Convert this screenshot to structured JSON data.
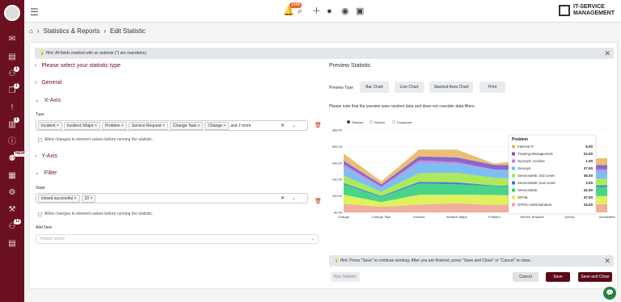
{
  "top": {
    "bell_badge": "1948",
    "logo_line1": "IT-SERVICE",
    "logo_line2": "MANAGEMENT"
  },
  "sidebar": {
    "badges": [
      "1",
      "1",
      "1",
      "1",
      "NEW",
      "11"
    ]
  },
  "breadcrumb": {
    "items": [
      "Statistics & Reports",
      "Edit Statistic"
    ]
  },
  "hint_top": "Hint: All fields marked with an asterisk (*) are mandatory.",
  "sections": {
    "s1": "Please select your statistic type",
    "s2": "General",
    "s3": "X-Axis",
    "s4": "Y-Axis",
    "s5": "Filter"
  },
  "xaxis": {
    "label": "Type",
    "tags": [
      "Incident",
      "Incident::Major",
      "Problem",
      "Service Request",
      "Change Task",
      "Change"
    ],
    "more": "and 2 more",
    "checkbox": "Allow changes to element values before running the statistic."
  },
  "filter": {
    "label": "State",
    "tags": [
      "closed successful",
      "23"
    ],
    "checkbox": "Allow changes to element values before running the statistic.",
    "add_new_label": "Add New",
    "add_new_placeholder": "Please select"
  },
  "preview": {
    "title": "Preview Statistic",
    "type_label": "Preview Type",
    "buttons": [
      "Bar Chart",
      "Line Chart",
      "Stacked Area Chart",
      "Print"
    ],
    "note": "Please note that the preview uses random data and does not consider data filters."
  },
  "hint_bottom": "Hint: Press \"Save\" to continue working. After you are finished, press \"Save and Close\" or \"Cancel\" to close.",
  "actions": {
    "run": "Run Statistic",
    "cancel": "Cancel",
    "save": "Save",
    "save_close": "Save and Close"
  },
  "colors": {
    "brand": "#6a1020",
    "fab": "#1e8a3c"
  },
  "chart_data": {
    "type": "area",
    "modes": [
      "Stacked",
      "Stream",
      "Expanded"
    ],
    "selected_mode": "Stacked",
    "x": [
      "Change",
      "Change Task",
      "Incident",
      "Incident::Major",
      "Problem",
      "Service Request",
      "Survey",
      "Unclassified"
    ],
    "y_ticks": [
      "383.00",
      "300.00",
      "200.00",
      "150.00",
      "100.00",
      "50.00"
    ],
    "series": [
      {
        "name": "Internal IT",
        "color": "#e8b866",
        "values": [
          34,
          14,
          32,
          36,
          6,
          28,
          30,
          32
        ]
      },
      {
        "name": "Training Management",
        "color": "#7b56c8",
        "values": [
          16,
          10,
          18,
          22,
          22,
          20,
          18,
          20
        ]
      },
      {
        "name": "Surveys::Archive",
        "color": "#c07de0",
        "values": [
          10,
          6,
          12,
          8,
          1,
          10,
          12,
          8
        ]
      },
      {
        "name": "Surveys",
        "color": "#6fb7f0",
        "values": [
          42,
          18,
          48,
          42,
          37,
          34,
          30,
          36
        ]
      },
      {
        "name": "Servicedesk::3rd Level",
        "color": "#a3e84a",
        "values": [
          36,
          20,
          40,
          44,
          36,
          32,
          34,
          30
        ]
      },
      {
        "name": "Servicedesk::2nd Level",
        "color": "#3a78c8",
        "values": [
          6,
          4,
          8,
          10,
          3,
          6,
          6,
          8
        ]
      },
      {
        "name": "Servicedesk",
        "color": "#34d07c",
        "values": [
          48,
          24,
          52,
          48,
          41,
          40,
          44,
          42
        ]
      },
      {
        "name": "SPAM",
        "color": "#dcf04a",
        "values": [
          42,
          22,
          46,
          40,
          47,
          36,
          40,
          38
        ]
      },
      {
        "name": "OTRS-Administration",
        "color": "#f0a592",
        "values": [
          40,
          26,
          36,
          42,
          34,
          40,
          36,
          38
        ]
      }
    ],
    "tooltip": {
      "title": "Problem",
      "values": [
        "6.00",
        "22.00",
        "1.00",
        "37.00",
        "36.00",
        "3.00",
        "41.00",
        "47.00",
        "34.00"
      ]
    }
  }
}
